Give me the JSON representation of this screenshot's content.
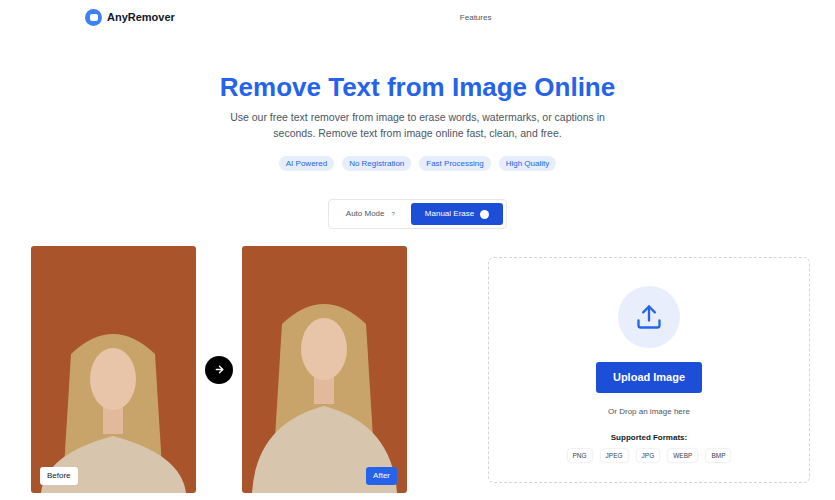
{
  "header": {
    "logo": "AnyRemover",
    "nav": [
      "Features"
    ]
  },
  "hero": {
    "title": "Remove Text from Image Online",
    "subtitle": [
      "Use our free text remover from image to erase words, watermarks, or captions in",
      "seconds. Remove text from image online fast, clean, and free."
    ],
    "badges": [
      "AI Powered",
      "No Registration",
      "Fast Processing",
      "High Quality"
    ]
  },
  "modes": [
    {
      "label": "Auto Mode",
      "selected": false,
      "help": "?"
    },
    {
      "label": "Manual Erase",
      "selected": true
    }
  ],
  "examples": [
    {
      "label": "Before",
      "kind": "before"
    },
    {
      "label": "After",
      "kind": "after"
    }
  ],
  "upload": {
    "button": "Upload Image",
    "hint": "Or Drop an image here",
    "formats_title": "Supported Formats:",
    "formats": [
      "PNG",
      "JPEG",
      "JPG",
      "WEBP",
      "BMP"
    ]
  }
}
